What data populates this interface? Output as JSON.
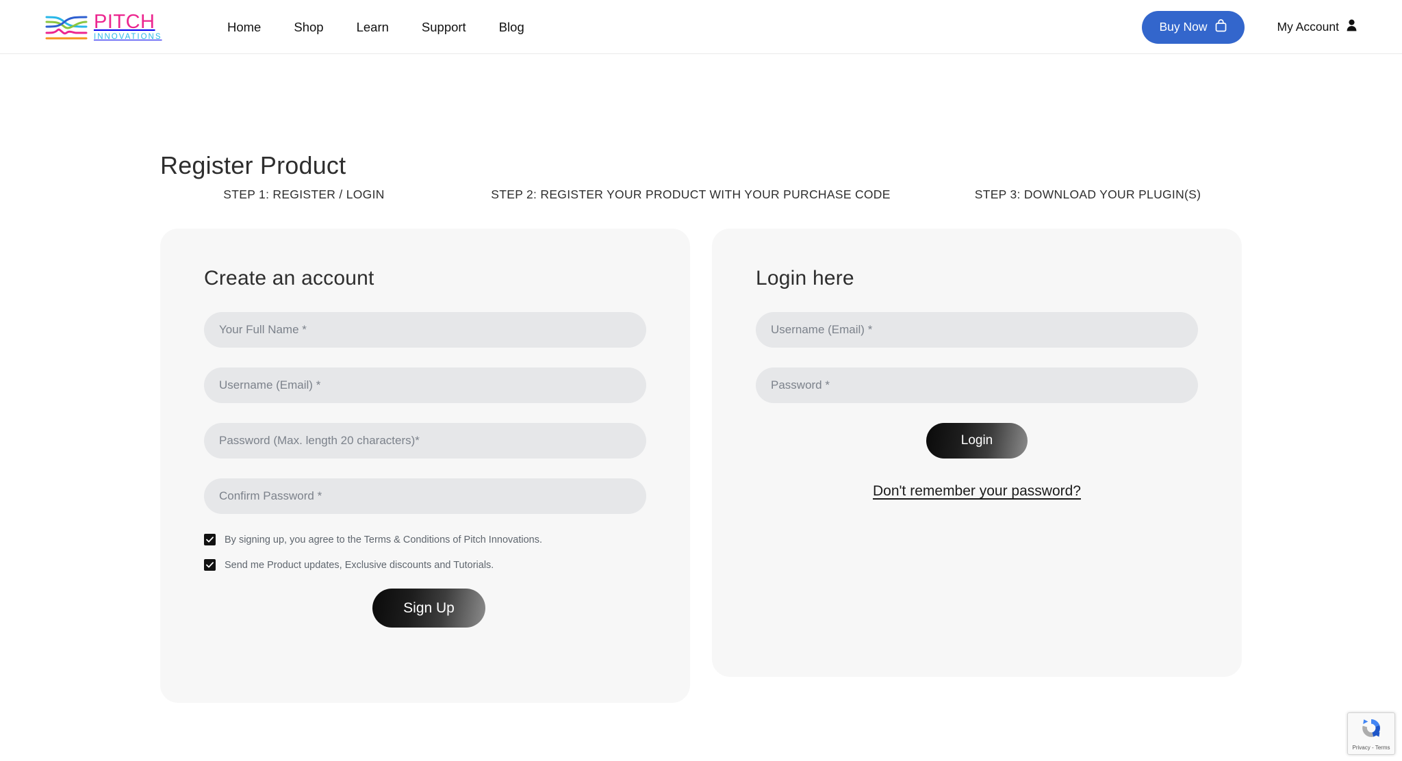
{
  "header": {
    "logo": {
      "word": "PITCH",
      "sub": "INNOVATIONS",
      "icon": "pitch-innovations-wave-logo",
      "colors": {
        "word": "#ec268f",
        "sub": "#29b7e8",
        "wave_cyan": "#29b7e8",
        "wave_green": "#8cc63f",
        "wave_blue": "#2e5fd0",
        "wave_magenta": "#ec268f",
        "wave_orange": "#f7941e"
      }
    },
    "nav": [
      {
        "label": "Home"
      },
      {
        "label": "Shop"
      },
      {
        "label": "Learn"
      },
      {
        "label": "Support"
      },
      {
        "label": "Blog"
      }
    ],
    "buy_now": {
      "label": "Buy Now",
      "icon": "shopping-bag-icon",
      "color": "#3366cc"
    },
    "my_account": {
      "label": "My Account",
      "icon": "user-icon"
    }
  },
  "main": {
    "page_title": "Register Product",
    "steps": [
      {
        "label": "STEP 1: REGISTER / LOGIN"
      },
      {
        "label": "STEP 2: REGISTER YOUR PRODUCT WITH YOUR PURCHASE CODE"
      },
      {
        "label": "STEP 3: DOWNLOAD YOUR PLUGIN(S)"
      }
    ],
    "signup_card": {
      "title": "Create an account",
      "fields": [
        {
          "name": "full-name",
          "value": "",
          "placeholder": "Your Full Name *"
        },
        {
          "name": "username-email",
          "value": "",
          "placeholder": "Username (Email) *"
        },
        {
          "name": "password",
          "value": "",
          "placeholder": "Password (Max. length 20 characters)*"
        },
        {
          "name": "confirm-password",
          "value": "",
          "placeholder": "Confirm Password *"
        }
      ],
      "checkboxes": [
        {
          "label": "By signing up, you agree to the Terms & Conditions of Pitch Innovations.",
          "checked": true
        },
        {
          "label": "Send me Product updates, Exclusive discounts and Tutorials.",
          "checked": true
        }
      ],
      "submit_label": "Sign Up"
    },
    "login_card": {
      "title": "Login here",
      "fields": [
        {
          "name": "login-username-email",
          "value": "",
          "placeholder": "Username (Email) *"
        },
        {
          "name": "login-password",
          "value": "",
          "placeholder": "Password *"
        }
      ],
      "submit_label": "Login",
      "forgot_label": "Don't remember your password?"
    }
  },
  "recaptcha": {
    "text": "Privacy - Terms",
    "icon": "recaptcha-logo"
  }
}
